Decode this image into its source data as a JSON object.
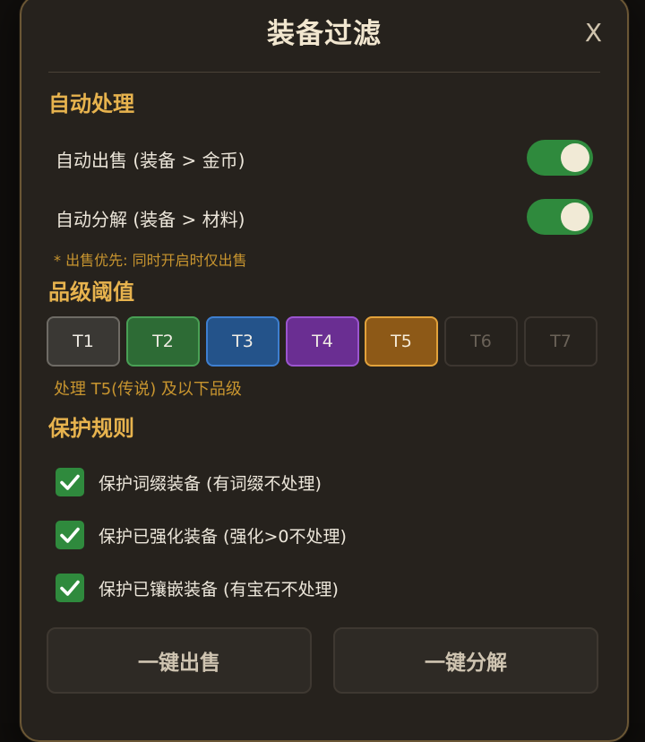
{
  "modal": {
    "title": "装备过滤",
    "close_label": "X"
  },
  "auto_process": {
    "section_title": "自动处理",
    "auto_sell": {
      "label": "自动出售 (装备 > 金币)",
      "enabled": true
    },
    "auto_salvage": {
      "label": "自动分解 (装备 > 材料)",
      "enabled": true
    },
    "note": "* 出售优先: 同时开启时仅出售"
  },
  "quality_threshold": {
    "section_title": "品级阈值",
    "tiers": [
      {
        "label": "T1",
        "color": "#3a3834"
      },
      {
        "label": "T2",
        "color": "#2d6b35"
      },
      {
        "label": "T3",
        "color": "#24538a"
      },
      {
        "label": "T4",
        "color": "#6a2e92"
      },
      {
        "label": "T5",
        "color": "#8d5917"
      },
      {
        "label": "T6",
        "color": "#26221d"
      },
      {
        "label": "T7",
        "color": "#26221d"
      }
    ],
    "selected": "T5",
    "note": "处理 T5(传说) 及以下品级"
  },
  "protection": {
    "section_title": "保护规则",
    "rules": [
      {
        "label": "保护词缀装备 (有词缀不处理)",
        "checked": true
      },
      {
        "label": "保护已强化装备 (强化>0不处理)",
        "checked": true
      },
      {
        "label": "保护已镶嵌装备 (有宝石不处理)",
        "checked": true
      }
    ]
  },
  "actions": {
    "sell_all": "一键出售",
    "salvage_all": "一键分解"
  },
  "colors": {
    "accent_gold": "#e7b34e",
    "toggle_on": "#2f8a3d",
    "panel_bg": "#26221d"
  }
}
